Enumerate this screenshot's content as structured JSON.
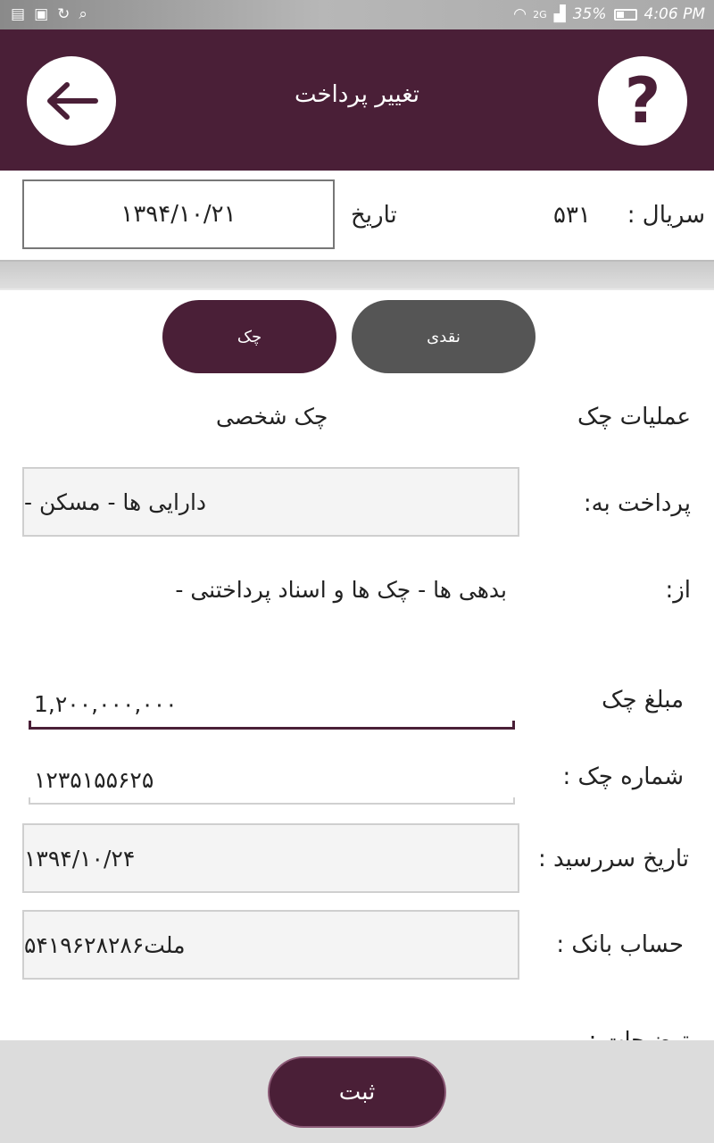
{
  "status_bar": {
    "network": "2G",
    "battery": "35%",
    "time": "4:06 PM",
    "left_icons": [
      "clipboard-icon",
      "image-icon",
      "refresh-icon",
      "search-icon"
    ]
  },
  "app_bar": {
    "title": "تغییر پرداخت",
    "back_icon": "arrow-left-icon",
    "help_icon": "question-icon",
    "help_glyph": "?"
  },
  "header": {
    "serial_label": "سریال :",
    "serial_value": "۵۳۱",
    "date_label": "تاریخ",
    "date_value": "۱۳۹۴/۱۰/۲۱"
  },
  "payment_type": {
    "cash_label": "نقدی",
    "cheque_label": "چک",
    "selected": "cheque"
  },
  "form": {
    "operation_label": "عملیات چک",
    "operation_value": "چک شخصی",
    "pay_to_label": "پرداخت به:",
    "pay_to_value": "دارایی ها - مسکن -",
    "from_label": "از:",
    "from_value": "بدهی ها - چک ها و اسناد پرداختنی -",
    "amount_label": "مبلغ چک",
    "amount_value": "1,۲۰۰,۰۰۰,۰۰۰",
    "cheque_number_label": "شماره چک :",
    "cheque_number_value": "۱۲۳۵۱۵۵۶۲۵",
    "due_date_label": "تاریخ سررسید :",
    "due_date_value": "۱۳۹۴/۱۰/۲۴",
    "bank_account_label": "حساب بانک :",
    "bank_account_value": "ملت۵۴۱۹۶۲۸۲۸۶",
    "description_label": "توضیحات :"
  },
  "actions": {
    "submit_label": "ثبت"
  },
  "colors": {
    "primary": "#4a1f37",
    "cash_button": "#555555",
    "background": "#ffffff",
    "bottom_bar": "#dcdcdc"
  }
}
